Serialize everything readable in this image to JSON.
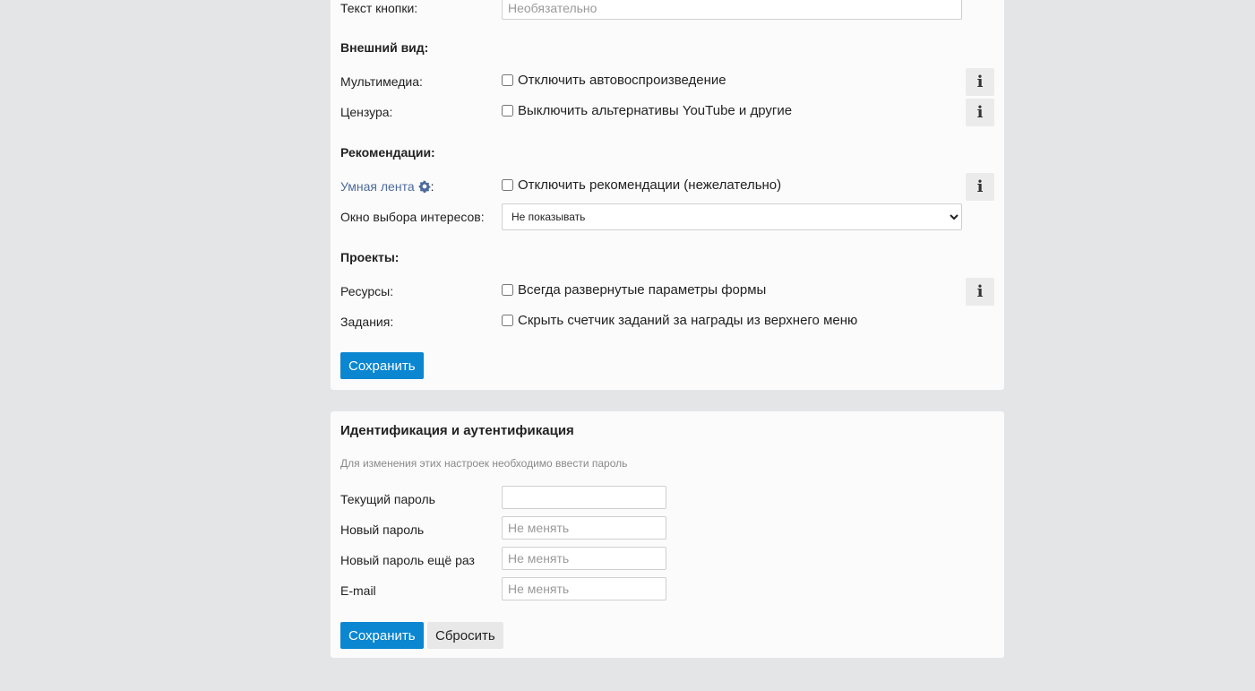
{
  "settings": {
    "button_text": {
      "label": "Текст кнопки:",
      "placeholder": "Необязательно"
    },
    "appearance": {
      "title": "Внешний вид:",
      "multimedia_label": "Мультимедиа:",
      "multimedia_option": "Отключить автовоспроизведение",
      "censorship_label": "Цензура:",
      "censorship_option": "Выключить альтернативы YouTube и другие"
    },
    "recommendations": {
      "title": "Рекомендации:",
      "smart_feed_link": "Умная лента",
      "smart_feed_colon": ":",
      "smart_feed_option": "Отключить рекомендации (нежелательно)",
      "interests_label": "Окно выбора интересов:",
      "interests_selected": "Не показывать"
    },
    "projects": {
      "title": "Проекты:",
      "resources_label": "Ресурсы:",
      "resources_option": "Всегда развернутые параметры формы",
      "tasks_label": "Задания:",
      "tasks_option": "Скрыть счетчик заданий за награды из верхнего меню"
    },
    "save_label": "Сохранить",
    "info_glyph": "i"
  },
  "auth": {
    "title": "Идентификация и аутентификация",
    "hint": "Для изменения этих настроек необходимо ввести пароль",
    "current_password_label": "Текущий пароль",
    "new_password_label": "Новый пароль",
    "new_password_placeholder": "Не менять",
    "repeat_password_label": "Новый пароль ещё раз",
    "repeat_password_placeholder": "Не менять",
    "email_label": "E-mail",
    "email_placeholder": "Не менять",
    "save_label": "Сохранить",
    "reset_label": "Сбросить"
  },
  "colors": {
    "page_background": "#e4e5e7",
    "panel_background": "#fbfbfb",
    "primary_button": "#0b86d1",
    "link": "#4d6a9c",
    "hint_text": "#8a8a8a"
  },
  "icons": [
    "info-icon",
    "gear-icon",
    "chevron-down-icon"
  ]
}
